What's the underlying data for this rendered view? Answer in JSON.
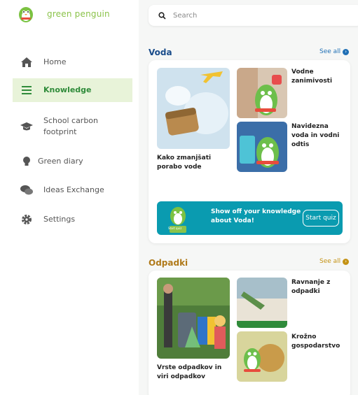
{
  "brand": {
    "name": "green penguin"
  },
  "search": {
    "placeholder": "Search"
  },
  "nav": [
    {
      "label": "Home",
      "icon": "home-icon"
    },
    {
      "label": "Knowledge",
      "icon": "list-icon",
      "active": true
    },
    {
      "label": "School carbon footprint",
      "icon": "graduation-cap-icon"
    },
    {
      "label": "Green diary",
      "icon": "lightbulb-icon"
    },
    {
      "label": "Ideas Exchange",
      "icon": "chat-icon"
    },
    {
      "label": "Settings",
      "icon": "gear-icon"
    }
  ],
  "sections": {
    "voda": {
      "title": "Voda",
      "see_all": "See all",
      "main_caption": "Kako zmanjšati porabo vode",
      "side_items": [
        "Vodne zanimivosti",
        "Navidezna voda in vodni odtis"
      ],
      "banner_text": "Show off your knowledge about Voda!",
      "banner_button": "Start quiz",
      "banner_badge": "Start quiz"
    },
    "odpadki": {
      "title": "Odpadki",
      "see_all": "See all",
      "main_caption": "Vrste odpadkov in viri odpadkov",
      "side_items": [
        "Ravnanje z odpadki",
        "Krožno gospodarstvo"
      ]
    }
  },
  "colors": {
    "brand_green": "#8bc34a",
    "active_bg": "#e8f3d9",
    "active_text": "#2f8b3a",
    "voda_title": "#1a4c8a",
    "voda_link": "#1f6fb5",
    "odpadki_title": "#b07a1a",
    "odpadki_link": "#c49214",
    "banner": "#0a9bb0"
  }
}
